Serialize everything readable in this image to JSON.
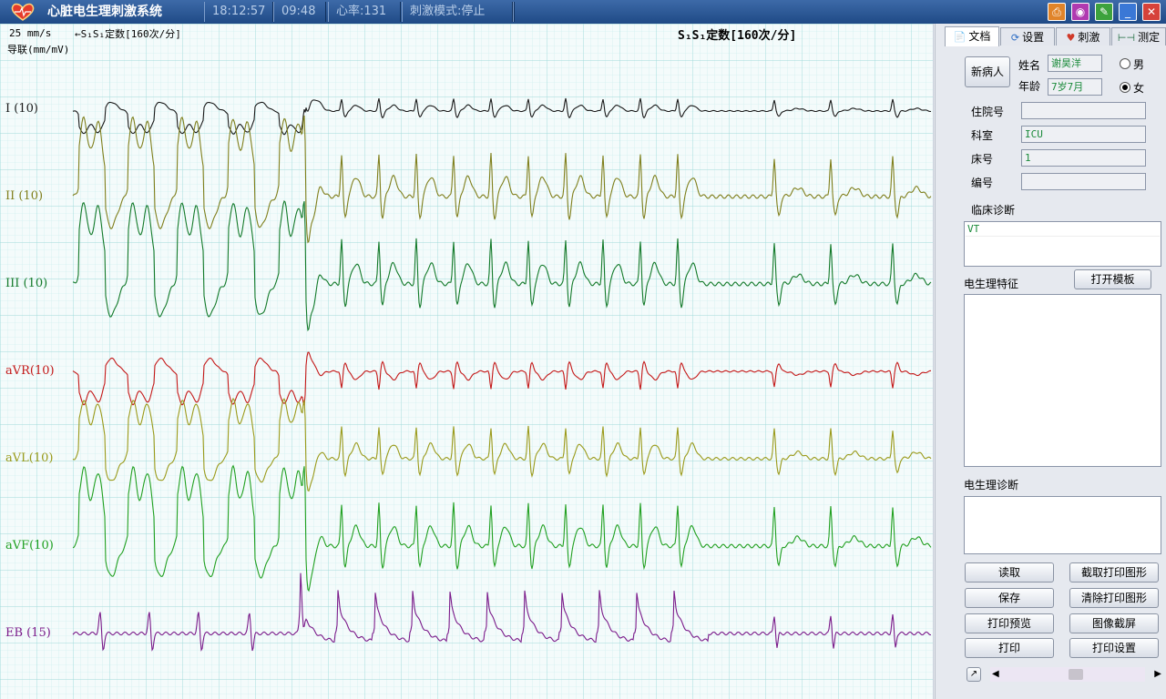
{
  "titlebar": {
    "app_name": "心脏电生理刺激系统",
    "clock": "18:12:57",
    "elapsed": "09:48",
    "heart_rate": "心率:131",
    "stim_mode": "刺激模式:停止",
    "buttons": [
      "printer-icon",
      "camera-icon",
      "edit-icon",
      "minimize-icon",
      "close-icon"
    ]
  },
  "ecg": {
    "speed": "25 mm/s",
    "gain": "导联(mm/mV)",
    "mode_small": "←S₁S₁定数[160次/分]",
    "mode_big": "S₁S₁定数[160次/分]",
    "leads": [
      {
        "label": "I (10)",
        "color": "#1a1a1a"
      },
      {
        "label": "II (10)",
        "color": "#7f7f1c"
      },
      {
        "label": "III (10)",
        "color": "#137a2a"
      },
      {
        "label": "aVR(10)",
        "color": "#c41818"
      },
      {
        "label": "aVL(10)",
        "color": "#9a9a1a"
      },
      {
        "label": "aVF(10)",
        "color": "#20a020"
      },
      {
        "label": "EB (15)",
        "color": "#7a1a8a"
      }
    ]
  },
  "panel": {
    "tabs": [
      {
        "label": "文档",
        "icon": "document-icon"
      },
      {
        "label": "设置",
        "icon": "settings-icon"
      },
      {
        "label": "刺激",
        "icon": "stimulus-icon"
      },
      {
        "label": "测定",
        "icon": "measure-icon"
      }
    ],
    "new_patient": "新病人",
    "name_label": "姓名",
    "name_value": "谢昊洋",
    "age_label": "年龄",
    "age_value": "7岁7月",
    "male_label": "男",
    "female_label": "女",
    "admission_label": "住院号",
    "admission_value": "",
    "department_label": "科室",
    "department_value": "ICU",
    "bed_label": "床号",
    "bed_value": "1",
    "number_label": "编号",
    "number_value": "",
    "clinical_dx_label": "临床诊断",
    "clinical_dx_value": "VT",
    "ep_features_label": "电生理特征",
    "open_template": "打开模板",
    "ep_dx_label": "电生理诊断",
    "buttons": {
      "read": "读取",
      "capture": "截取打印图形",
      "save": "保存",
      "clear": "清除打印图形",
      "preview": "打印预览",
      "screenshot": "图像截屏",
      "print": "打印",
      "print_settings": "打印设置"
    }
  }
}
